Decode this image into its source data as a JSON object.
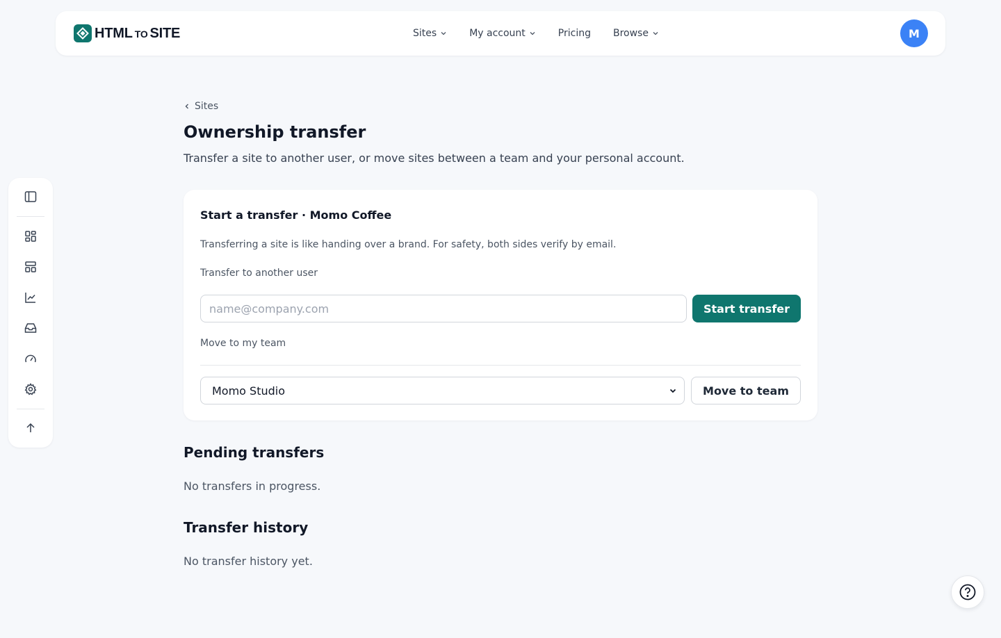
{
  "header": {
    "logo_main": "HTML",
    "logo_small": "TO",
    "logo_end": "SITE",
    "nav": [
      {
        "label": "Sites",
        "has_dropdown": true
      },
      {
        "label": "My account",
        "has_dropdown": true
      },
      {
        "label": "Pricing",
        "has_dropdown": false
      },
      {
        "label": "Browse",
        "has_dropdown": true
      }
    ],
    "avatar_initial": "M"
  },
  "sidebar": {
    "items": [
      "panel-toggle-icon",
      "dashboard-icon",
      "layout-icon",
      "analytics-icon",
      "inbox-icon",
      "speed-icon",
      "settings-icon",
      "arrow-up-icon"
    ]
  },
  "main": {
    "breadcrumb": "Sites",
    "title": "Ownership transfer",
    "subtitle": "Transfer a site to another user, or move sites between a team and your personal account."
  },
  "card": {
    "title": "Start a transfer · Momo Coffee",
    "note": "Transferring a site is like handing over a brand. For safety, both sides verify by email.",
    "user_label": "Transfer to another user",
    "email_placeholder": "name@company.com",
    "email_value": "",
    "start_button": "Start transfer",
    "team_label": "Move to my team",
    "team_selected": "Momo Studio",
    "move_button": "Move to team"
  },
  "pending": {
    "title": "Pending transfers",
    "empty": "No transfers in progress."
  },
  "history": {
    "title": "Transfer history",
    "empty": "No transfer history yet."
  },
  "colors": {
    "accent": "#0f766e",
    "avatar": "#3b82f6",
    "background": "#f6f8fb"
  }
}
